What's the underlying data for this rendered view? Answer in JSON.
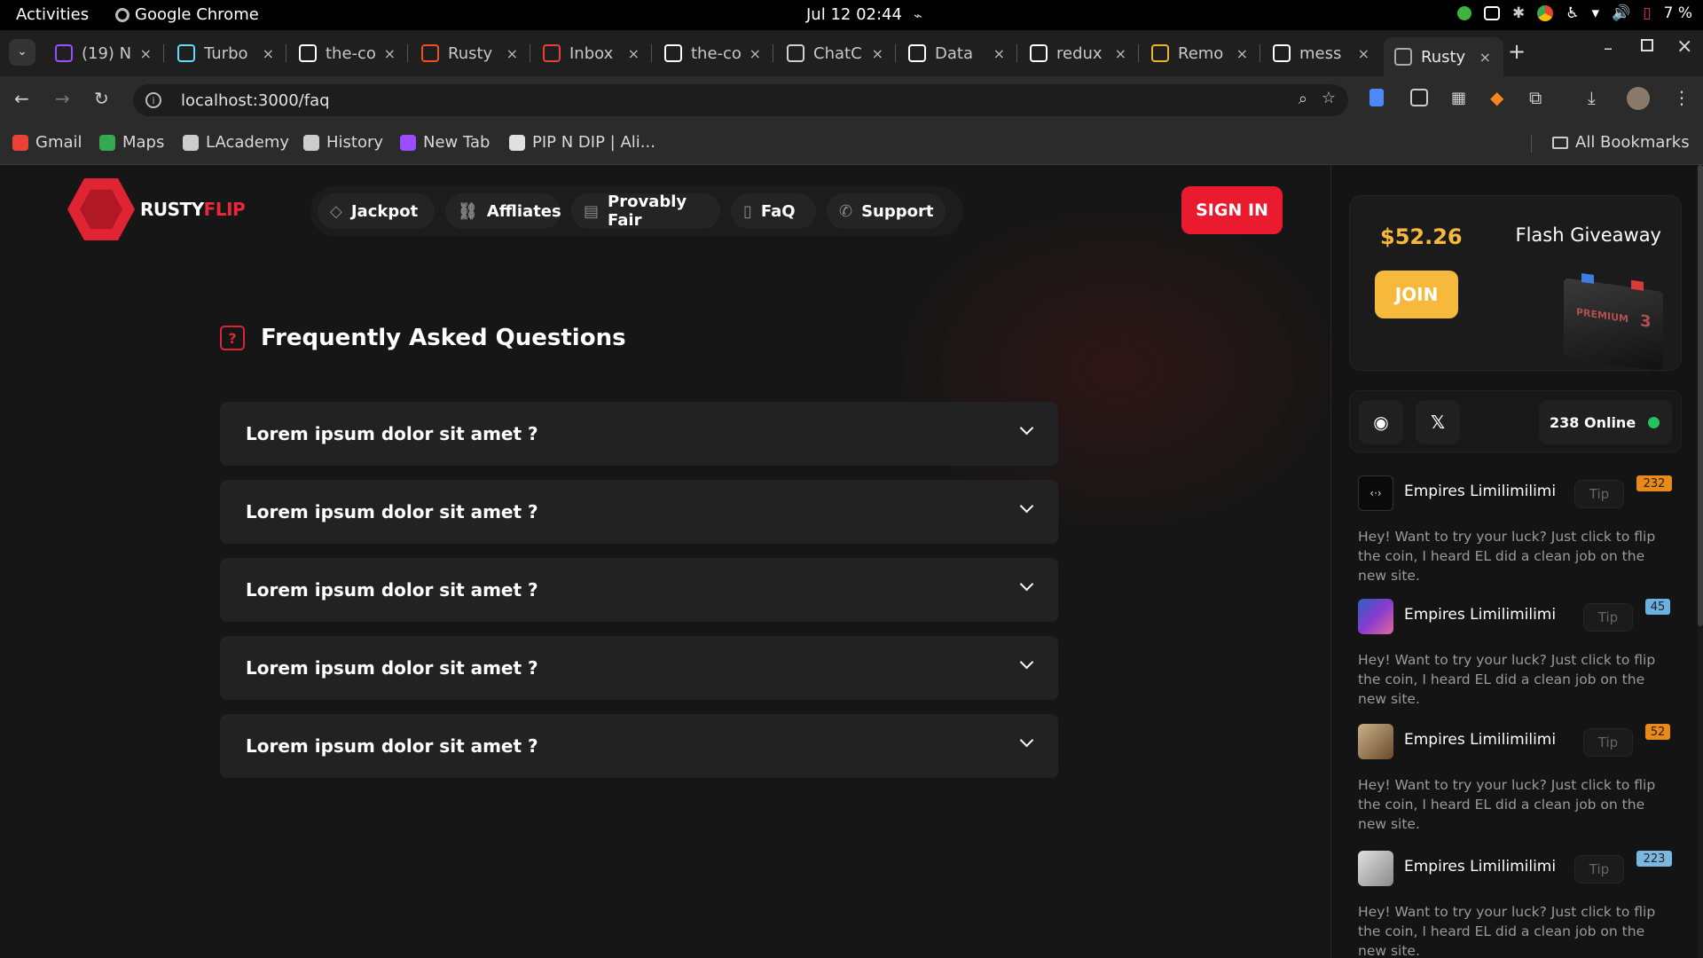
{
  "os": {
    "activities": "Activities",
    "app_name": "Google Chrome",
    "clock": "Jul 12  02:44",
    "battery": "7 %"
  },
  "tabs": [
    {
      "label": "(19) N",
      "icon": "messenger-icon",
      "color": "#9b4dff"
    },
    {
      "label": "Turbo",
      "icon": "react-icon",
      "color": "#61dafb"
    },
    {
      "label": "the-co",
      "icon": "github-icon",
      "color": "#ffffff"
    },
    {
      "label": "Rusty",
      "icon": "figma-icon",
      "color": "#f24e1e"
    },
    {
      "label": "Inbox",
      "icon": "gmail-icon",
      "color": "#ea4335"
    },
    {
      "label": "the-co",
      "icon": "github-icon",
      "color": "#ffffff"
    },
    {
      "label": "ChatC",
      "icon": "chatgpt-icon",
      "color": "#d0d0d0"
    },
    {
      "label": "Data",
      "icon": "data-icon",
      "color": "#ffffff"
    },
    {
      "label": "redux",
      "icon": "google-icon",
      "color": "#ffffff"
    },
    {
      "label": "Remo",
      "icon": "remote-icon",
      "color": "#f0b429"
    },
    {
      "label": "mess",
      "icon": "google-icon",
      "color": "#ffffff"
    },
    {
      "label": "Rusty",
      "icon": "globe-icon",
      "color": "#aaaaaa"
    }
  ],
  "address": {
    "url": "localhost:3000/faq"
  },
  "bookmarks": [
    {
      "label": "Gmail",
      "color": "#ea4335"
    },
    {
      "label": "Maps",
      "color": "#34a853"
    },
    {
      "label": "LAcademy",
      "color": "#cccccc"
    },
    {
      "label": "History",
      "color": "#cccccc"
    },
    {
      "label": "New Tab",
      "color": "#9b4dff"
    },
    {
      "label": "PIP N DIP | Ali...",
      "color": "#e0e0e0"
    }
  ],
  "all_bookmarks": "All Bookmarks",
  "site": {
    "brand_white": "RUSTY",
    "brand_red": "FLIP",
    "nav": [
      "Jackpot",
      "Affliates",
      "Provably Fair",
      "FaQ",
      "Support"
    ],
    "sign_in": "SIGN IN",
    "faq_title": "Frequently Asked Questions",
    "faq_items": [
      "Lorem ipsum dolor sit amet ?",
      "Lorem ipsum dolor sit amet ?",
      "Lorem ipsum dolor sit amet ?",
      "Lorem ipsum dolor sit amet ?",
      "Lorem ipsum dolor sit amet ?"
    ]
  },
  "sidebar": {
    "amount": "$52.26",
    "giveaway_title": "Flash Giveaway",
    "join": "JOIN",
    "battery_text": "PREMIUM",
    "battery_num": "3",
    "online": "238 Online",
    "messages": [
      {
        "user": "Empires Limilimilimi",
        "tip": "Tip",
        "level": "232",
        "level_color": "#e8891a",
        "avatar_color": "#0a0a0a",
        "text": "Hey! Want to try your luck? Just click to flip the coin, I heard EL did a clean job on the new site."
      },
      {
        "user": "Empires Limilimilimi",
        "tip": "Tip",
        "level": "45",
        "level_color": "#6ab0e0",
        "avatar_color": "#5a3fb0",
        "text": "Hey! Want to try your luck? Just click to flip the coin, I heard EL did a clean job on the new site."
      },
      {
        "user": "Empires Limilimilimi",
        "tip": "Tip",
        "level": "52",
        "level_color": "#e8891a",
        "avatar_color": "#8a6a4a",
        "text": "Hey! Want to try your luck? Just click to flip the coin, I heard EL did a clean job on the new site."
      },
      {
        "user": "Empires Limilimilimi",
        "tip": "Tip",
        "level": "223",
        "level_color": "#7ab8e0",
        "avatar_color": "#cfcfcf",
        "text": "Hey! Want to try your luck? Just click to flip the coin, I heard EL did a clean job on the new site."
      }
    ]
  }
}
